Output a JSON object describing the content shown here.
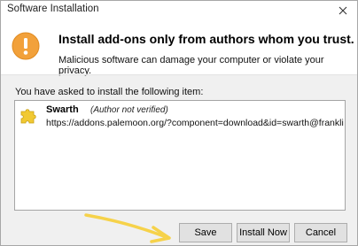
{
  "window": {
    "title": "Software Installation",
    "close_icon": "close-icon",
    "close_label": "✕"
  },
  "header": {
    "icon": "warning-icon",
    "headline": "Install add-ons only from authors whom you trust.",
    "subline": "Malicious software can damage your computer or violate your privacy."
  },
  "items_section": {
    "label": "You have asked to install the following item:",
    "items": [
      {
        "icon": "puzzle-piece-icon",
        "name": "Swarth",
        "status": "(Author not verified)",
        "url": "https://addons.palemoon.org/?component=download&id=swarth@franklindm&ver"
      }
    ]
  },
  "buttons": {
    "save": "Save",
    "install_now": "Install Now",
    "cancel": "Cancel"
  },
  "annotation": {
    "icon": "arrow-icon",
    "color": "#f6d24a"
  },
  "colors": {
    "warning_orange": "#f2a13b",
    "puzzle_yellow": "#f1c933"
  }
}
